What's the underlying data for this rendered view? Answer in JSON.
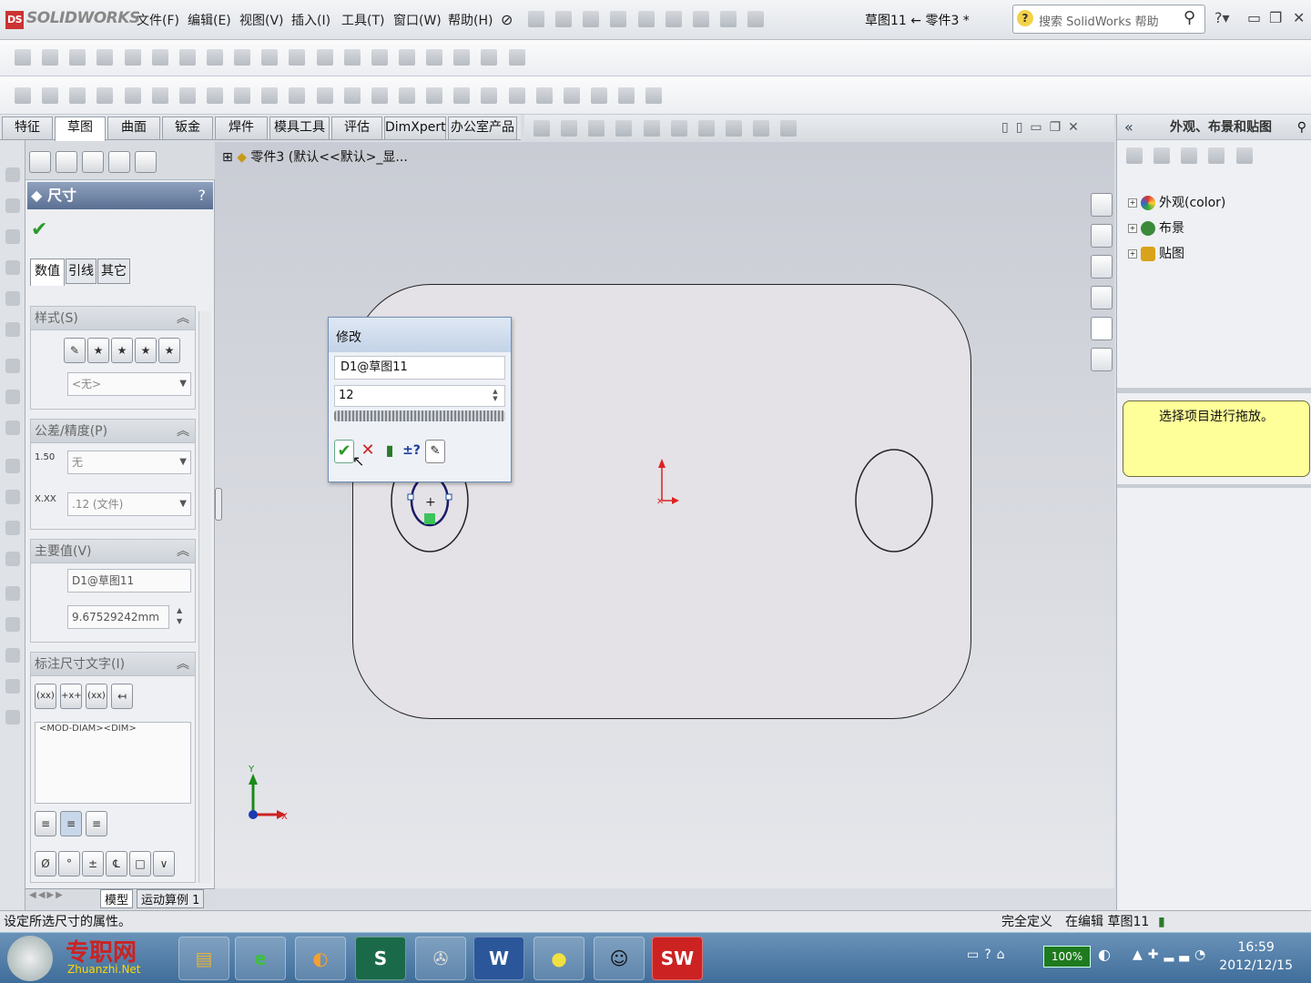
{
  "app": {
    "logo_text": "SOLIDWORKS",
    "menu": [
      "文件(F)",
      "编辑(E)",
      "视图(V)",
      "插入(I)",
      "工具(T)",
      "窗口(W)",
      "帮助(H)"
    ],
    "document_title": "草图11 ← 零件3 *",
    "search_placeholder": "搜索 SolidWorks 帮助"
  },
  "command_tabs": [
    "特征",
    "草图",
    "曲面",
    "钣金",
    "焊件",
    "模具工具",
    "评估",
    "DimXpert",
    "办公室产品"
  ],
  "active_tab": "草图",
  "property_manager": {
    "title": "尺寸",
    "help": "?",
    "subtabs": [
      "数值",
      "引线",
      "其它"
    ],
    "style_group": {
      "title": "样式(S)",
      "select_value": "<无>"
    },
    "tolerance_group": {
      "title": "公差/精度(P)",
      "tolerance_type": "无",
      "precision": ".12 (文件)"
    },
    "primary_value_group": {
      "title": "主要值(V)",
      "name": "D1@草图11",
      "value": "9.67529242mm"
    },
    "dim_text_group": {
      "title": "标注尺寸文字(I)",
      "text": "<MOD-DIAM><DIM>",
      "btn_labels": [
        "(xx)",
        "+x+",
        "(xx)"
      ]
    },
    "symbol_buttons": [
      "Ø",
      "°",
      "±",
      "℄",
      "□",
      "∨"
    ],
    "bottom_tabs": [
      "模型",
      "运动算例 1"
    ]
  },
  "feature_tree": {
    "root_label": "零件3 (默认<<默认>_显..."
  },
  "modify_dialog": {
    "title": "修改",
    "name": "D1@草图11",
    "value": "12"
  },
  "task_pane": {
    "title": "外观、布景和贴图",
    "items": [
      "外观(color)",
      "布景",
      "贴图"
    ],
    "drop_hint": "选择项目进行拖放。"
  },
  "status": {
    "left": "设定所选尺寸的属性。",
    "state": "完全定义",
    "editing": "在编辑 草图11"
  },
  "taskbar": {
    "time": "16:59",
    "date": "2012/12/15",
    "battery": "100%"
  },
  "watermark": {
    "name": "专职网",
    "url": "Zhuanzhi.Net"
  },
  "colors": {
    "pm_header": "#5a6f93",
    "part_face": "#e4e2e6",
    "drop_hint_bg": "#ffff99",
    "ok_green": "#2a9a2a",
    "cancel_red": "#cc2222"
  }
}
